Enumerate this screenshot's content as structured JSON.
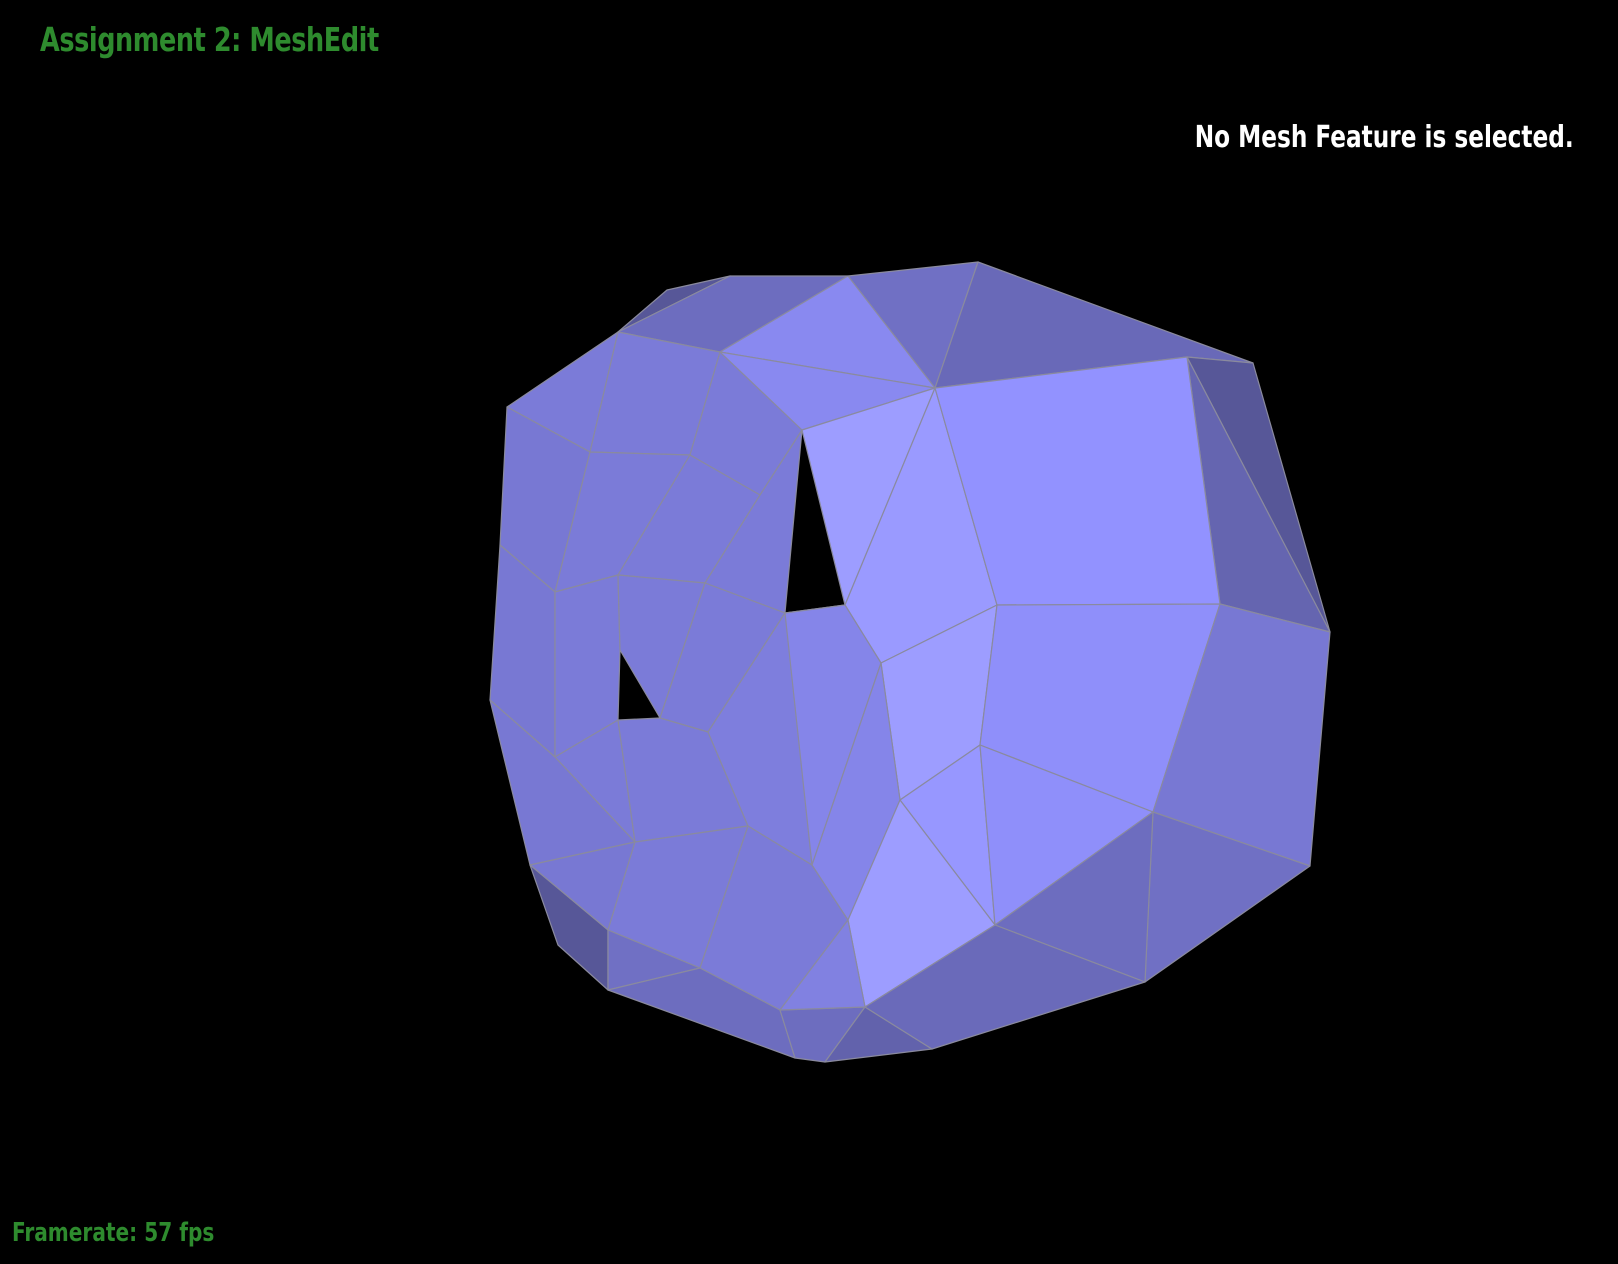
{
  "app": {
    "title": "Assignment 2: MeshEdit"
  },
  "status": {
    "selection_text": "No Mesh Feature is selected.",
    "framerate_text": "Framerate: 57 fps"
  },
  "colors": {
    "background": "#000000",
    "title_text": "#2e8b2e",
    "status_text": "#ffffff",
    "mesh_base": "#8c8cf5",
    "mesh_edge": "#8a8a9e"
  },
  "viewport": {
    "content": "3D triangle mesh viewer"
  }
}
